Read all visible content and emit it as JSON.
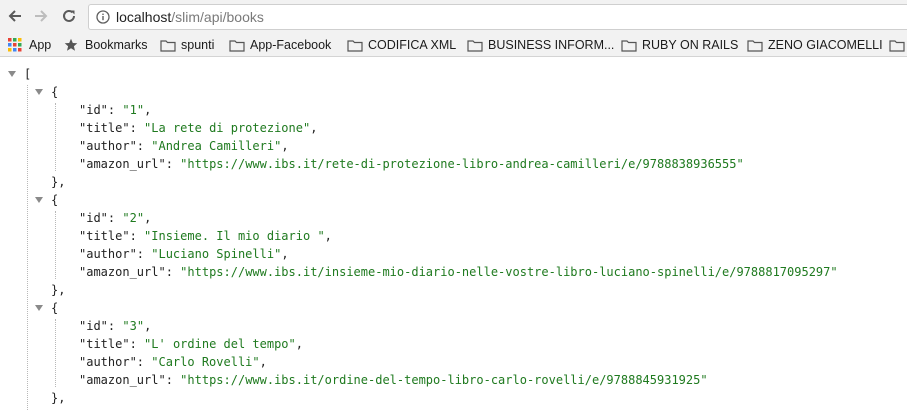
{
  "address": {
    "host": "localhost",
    "path": "/slim/api/books"
  },
  "bookmarks": [
    {
      "label": "App",
      "icon": "apps-grid-icon"
    },
    {
      "label": "Bookmarks",
      "icon": "star-icon"
    },
    {
      "label": "spunti",
      "icon": "folder-icon"
    },
    {
      "label": "App-Facebook",
      "icon": "folder-icon"
    },
    {
      "label": "CODIFICA XML",
      "icon": "folder-icon"
    },
    {
      "label": "BUSINESS INFORM...",
      "icon": "folder-icon"
    },
    {
      "label": "RUBY ON RAILS",
      "icon": "folder-icon"
    },
    {
      "label": "ZENO GIACOMELLI",
      "icon": "folder-icon"
    }
  ],
  "json": {
    "open_bracket": "[",
    "open_brace": "{",
    "close_brace": "},",
    "books": [
      {
        "id": "1",
        "title": "La rete di protezione",
        "author": "Andrea Camilleri",
        "amazon_url": "https://www.ibs.it/rete-di-protezione-libro-andrea-camilleri/e/9788838936555"
      },
      {
        "id": "2",
        "title": "Insieme. Il mio diario ",
        "author": "Luciano Spinelli",
        "amazon_url": "https://www.ibs.it/insieme-mio-diario-nelle-vostre-libro-luciano-spinelli/e/9788817095297"
      },
      {
        "id": "3",
        "title": "L' ordine del tempo",
        "author": "Carlo Rovelli",
        "amazon_url": "https://www.ibs.it/ordine-del-tempo-libro-carlo-rovelli/e/9788845931925"
      }
    ]
  }
}
